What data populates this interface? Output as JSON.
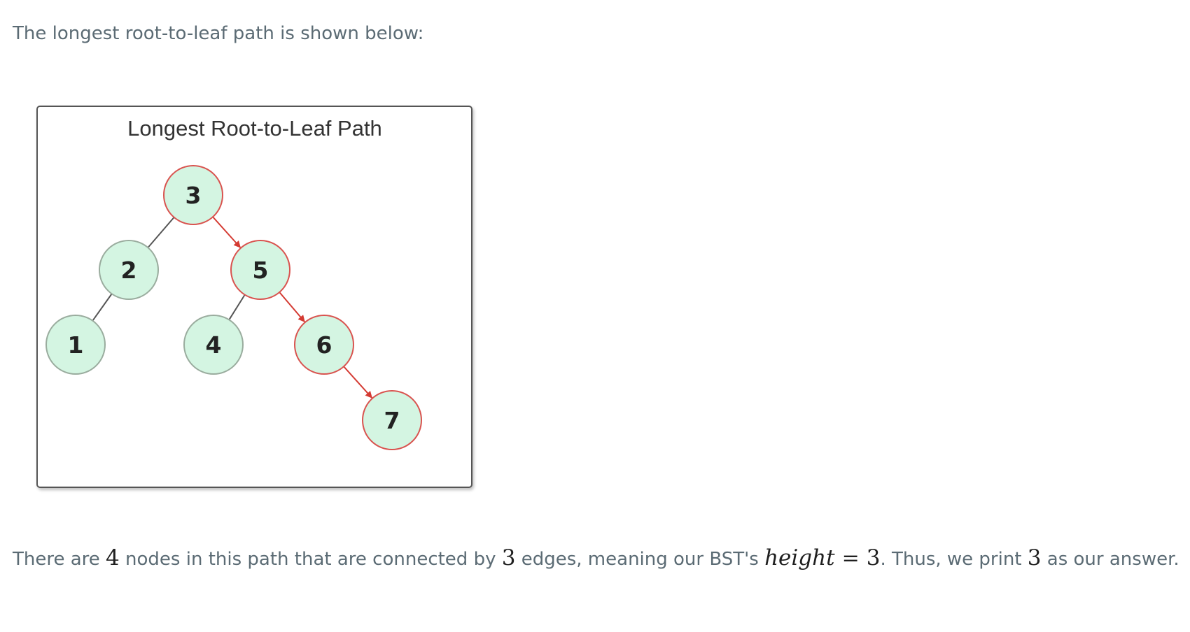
{
  "intro_text": "The longest root-to-leaf path is shown below:",
  "diagram": {
    "title": "Longest Root-to-Leaf Path",
    "nodes": [
      {
        "id": "n3",
        "label": "3",
        "on_path": true
      },
      {
        "id": "n2",
        "label": "2",
        "on_path": false
      },
      {
        "id": "n5",
        "label": "5",
        "on_path": true
      },
      {
        "id": "n1",
        "label": "1",
        "on_path": false
      },
      {
        "id": "n4",
        "label": "4",
        "on_path": false
      },
      {
        "id": "n6",
        "label": "6",
        "on_path": true
      },
      {
        "id": "n7",
        "label": "7",
        "on_path": true
      }
    ],
    "edges": [
      {
        "from": "n3",
        "to": "n2",
        "on_path": false
      },
      {
        "from": "n3",
        "to": "n5",
        "on_path": true
      },
      {
        "from": "n2",
        "to": "n1",
        "on_path": false
      },
      {
        "from": "n5",
        "to": "n4",
        "on_path": false
      },
      {
        "from": "n5",
        "to": "n6",
        "on_path": true
      },
      {
        "from": "n6",
        "to": "n7",
        "on_path": true
      }
    ],
    "colors": {
      "node_fill": "#d4f5e2",
      "path_stroke": "#d9534f",
      "normal_stroke": "#9aac9e",
      "path_edge": "#d43a32",
      "normal_edge": "#555555"
    }
  },
  "answer": {
    "part1": "There are ",
    "nodes_count": "4",
    "part2": " nodes in this path that are connected by ",
    "edges_count": "3",
    "part3": " edges, meaning our BST's ",
    "height_var": "height",
    "equals": "=",
    "height_value": "3",
    "part4": ". Thus, we print ",
    "print_value": "3",
    "part5": " as our answer."
  }
}
